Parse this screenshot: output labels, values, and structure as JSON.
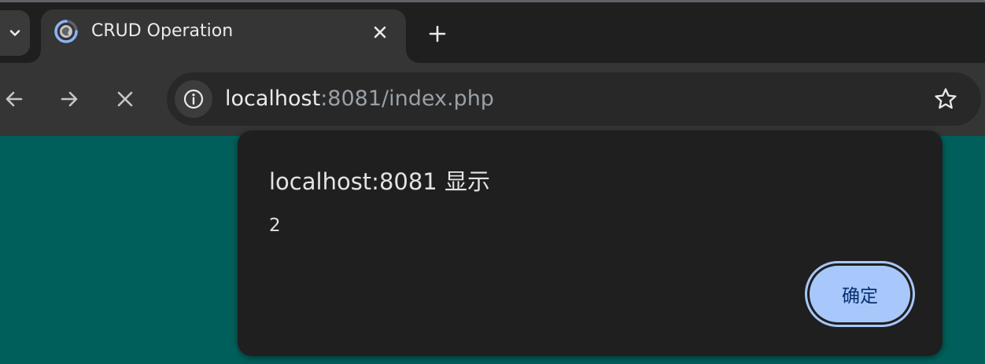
{
  "browser": {
    "tab": {
      "title": "CRUD Operation",
      "favicon": "loading-spinner-icon"
    },
    "omnibox": {
      "url_host": "localhost",
      "url_rest": ":8081/index.php"
    },
    "icons": {
      "tab_search": "chevron-down-icon",
      "tab_close": "close-icon",
      "new_tab": "plus-icon",
      "back": "arrow-left-icon",
      "forward": "arrow-right-icon",
      "stop": "close-icon",
      "site_info": "info-icon",
      "bookmark": "star-icon"
    }
  },
  "dialog": {
    "title": "localhost:8081 显示",
    "message": "2",
    "ok_label": "确定"
  },
  "colors": {
    "page_background": "#005f5a",
    "dialog_background": "#1f1f1f",
    "button_accent": "#a8c7fa"
  }
}
